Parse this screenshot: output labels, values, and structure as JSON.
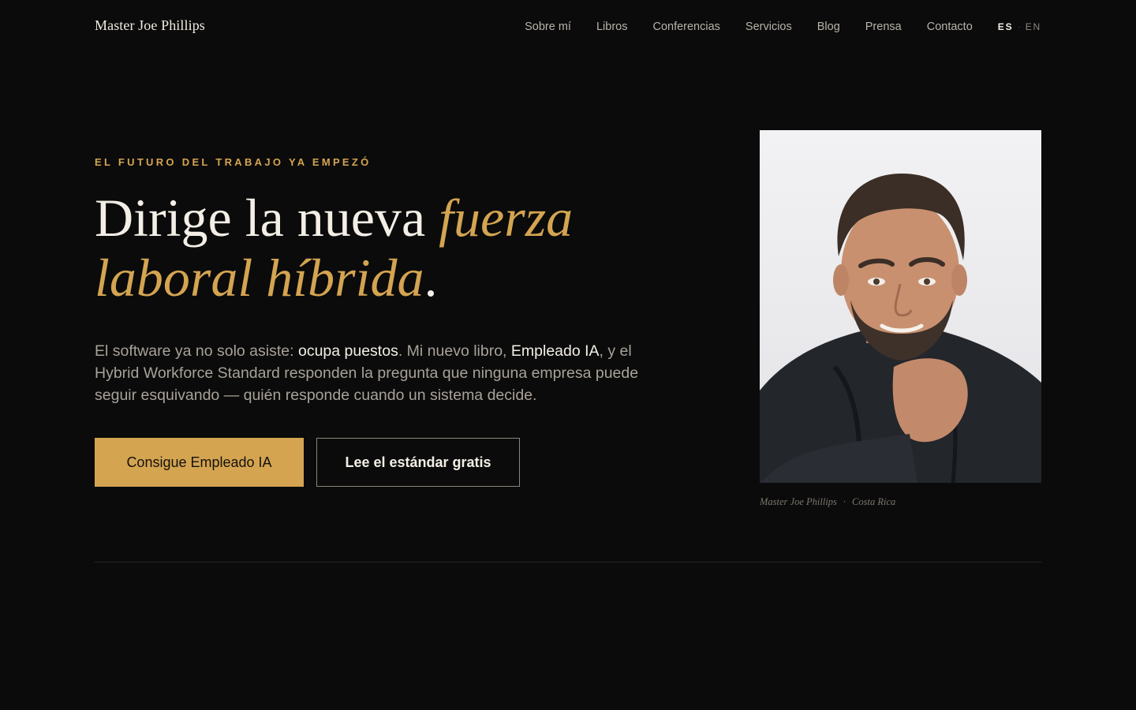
{
  "header": {
    "logo": "Master Joe Phillips",
    "nav": [
      "Sobre mí",
      "Libros",
      "Conferencias",
      "Servicios",
      "Blog",
      "Prensa",
      "Contacto"
    ],
    "lang_active": "ES",
    "lang_inactive": "EN",
    "lang_separator": "·"
  },
  "hero": {
    "eyebrow": "EL FUTURO DEL TRABAJO YA EMPEZÓ",
    "headline_plain": "Dirige la nueva ",
    "headline_accent": "fuerza laboral híbrida",
    "headline_end": ".",
    "lede": {
      "p1": "El software ya no solo asiste: ",
      "h1": "ocupa puestos",
      "p2": ". Mi nuevo libro, ",
      "h2": "Empleado IA",
      "p3": ", y el Hybrid Workforce Standard responden la pregunta que ninguna empresa puede seguir esquivando — quién responde cuando un sistema decide."
    },
    "cta_primary": "Consigue Empleado IA",
    "cta_secondary": "Lee el estándar gratis"
  },
  "portrait": {
    "caption_name": "Master Joe Phillips",
    "caption_sep": "·",
    "caption_place": "Costa Rica"
  },
  "colors": {
    "background": "#0b0b0b",
    "accent_gold": "#d4a451",
    "text_primary": "#f3efe6",
    "text_muted": "#a8a299"
  }
}
